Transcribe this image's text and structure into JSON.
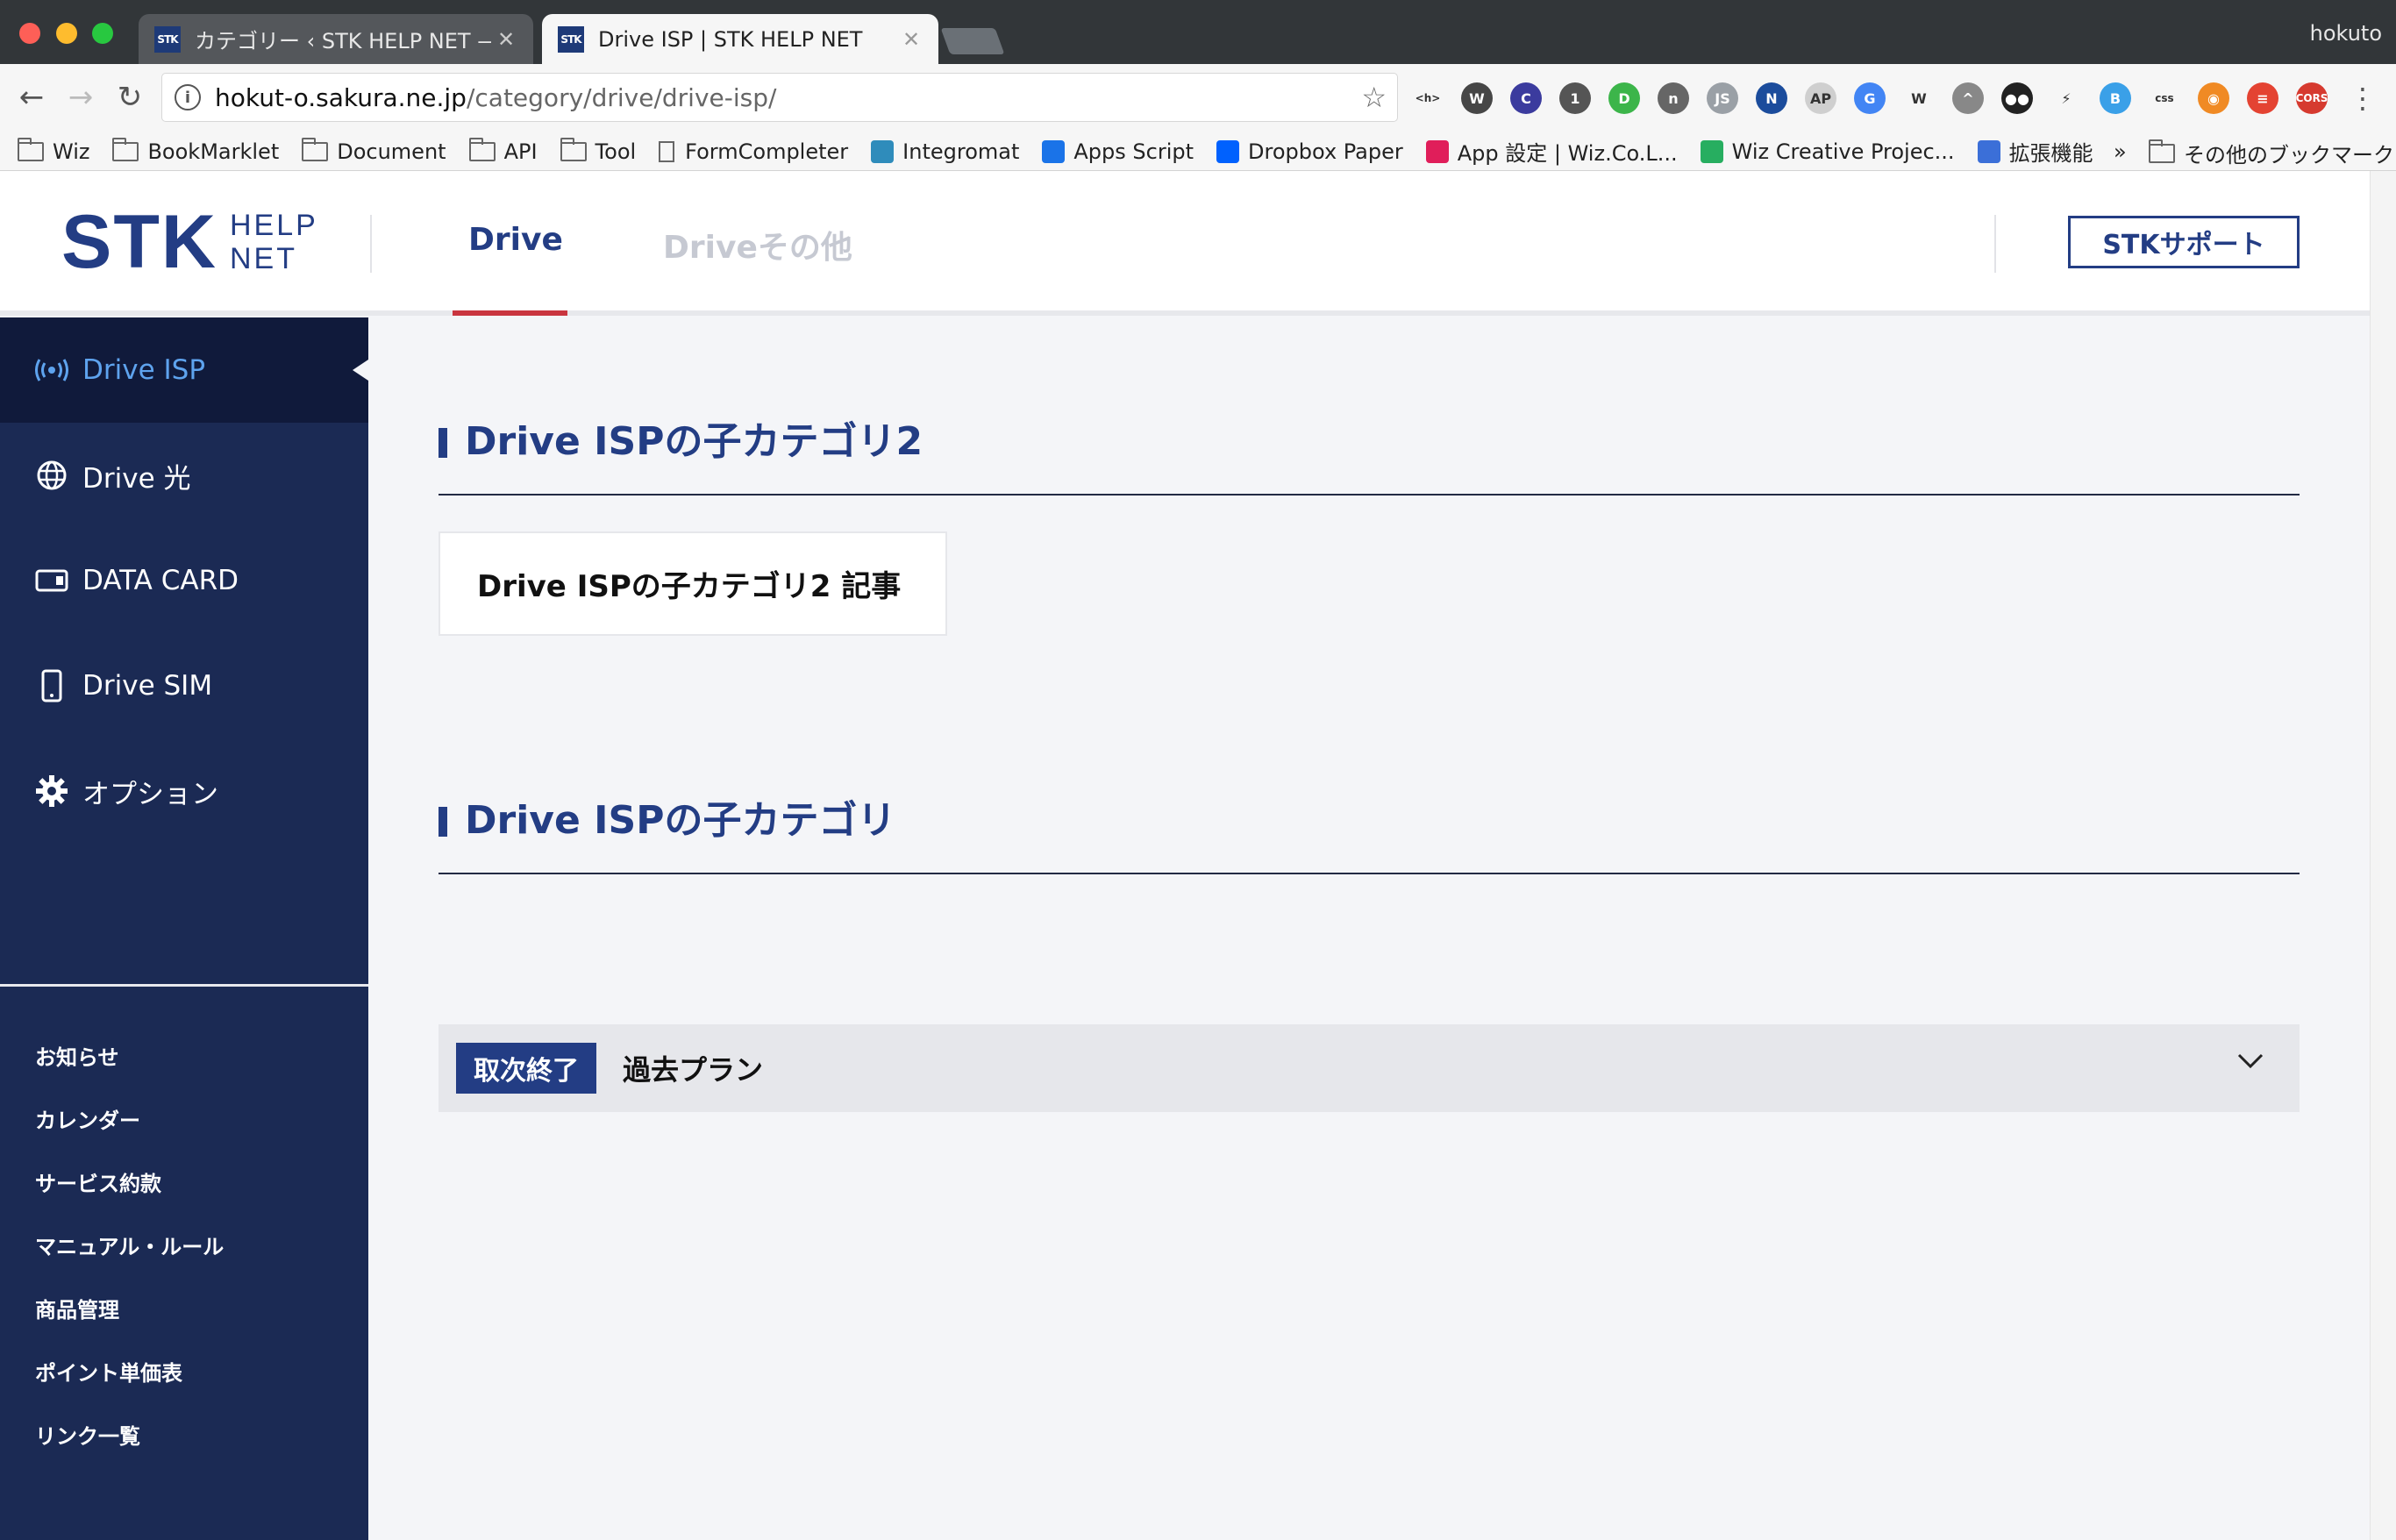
{
  "browser": {
    "tabs": [
      {
        "favicon": "STK",
        "title": "カテゴリー ‹ STK HELP NET —",
        "active": false
      },
      {
        "favicon": "STK",
        "title": "Drive ISP | STK HELP NET",
        "active": true
      }
    ],
    "profile_name": "hokuto",
    "url_host": "hokut-o.sakura.ne.jp",
    "url_path": "/category/drive/drive-isp/",
    "extensions": [
      {
        "icon": "html-tag-icon",
        "text": "<h>",
        "color": "#f6f6f6"
      },
      {
        "icon": "wordpress-icon",
        "text": "W",
        "color": "#464646"
      },
      {
        "icon": "c-circle-icon",
        "text": "C",
        "color": "#3b3b9e"
      },
      {
        "icon": "1password-icon",
        "text": "1",
        "color": "#555555"
      },
      {
        "icon": "green-d-icon",
        "text": "D",
        "color": "#3cb54a"
      },
      {
        "icon": "hex-n-icon",
        "text": "n",
        "color": "#666666"
      },
      {
        "icon": "js-icon",
        "text": "JS",
        "color": "#9aa0a6"
      },
      {
        "icon": "n-frame-icon",
        "text": "N",
        "color": "#1b4c9c"
      },
      {
        "icon": "ap-icon",
        "text": "AP",
        "color": "#cfcfcf"
      },
      {
        "icon": "translate-icon",
        "text": "G",
        "color": "#4285f4"
      },
      {
        "icon": "w-icon",
        "text": "W",
        "color": "#f6f6f6"
      },
      {
        "icon": "hat-icon",
        "text": "^",
        "color": "#888888"
      },
      {
        "icon": "tampermonkey-icon",
        "text": "●●",
        "color": "#222222"
      },
      {
        "icon": "bolt-icon",
        "text": "⚡",
        "color": "#f6f6f6"
      },
      {
        "icon": "pb-icon",
        "text": "B",
        "color": "#3aa0e8"
      },
      {
        "icon": "css-icon",
        "text": "css",
        "color": "#f6f6f6"
      },
      {
        "icon": "rss-icon",
        "text": "◉",
        "color": "#f08a24"
      },
      {
        "icon": "todoist-icon",
        "text": "≡",
        "color": "#e44332"
      },
      {
        "icon": "cors-icon",
        "text": "CORS",
        "color": "#d63a2f"
      }
    ],
    "bookmarks": [
      {
        "type": "folder",
        "label": "Wiz"
      },
      {
        "type": "folder",
        "label": "BookMarklet"
      },
      {
        "type": "folder",
        "label": "Document"
      },
      {
        "type": "folder",
        "label": "API"
      },
      {
        "type": "folder",
        "label": "Tool"
      },
      {
        "type": "page",
        "label": "FormCompleter"
      },
      {
        "type": "integromat",
        "label": "Integromat"
      },
      {
        "type": "apps-script",
        "label": "Apps Script"
      },
      {
        "type": "dropbox",
        "label": "Dropbox Paper"
      },
      {
        "type": "slack",
        "label": "App 設定 | Wiz.Co.L..."
      },
      {
        "type": "wiz",
        "label": "Wiz Creative Projec..."
      },
      {
        "type": "puzzle",
        "label": "拡張機能"
      }
    ],
    "bookmarks_overflow": "»",
    "other_bookmarks": "その他のブックマーク"
  },
  "site": {
    "logo_main": "STK",
    "logo_sub_1": "HELP",
    "logo_sub_2": "NET",
    "nav": [
      {
        "label": "Drive",
        "active": true
      },
      {
        "label": "Driveその他",
        "active": false
      }
    ],
    "support_button": "STKサポート"
  },
  "sidebar": {
    "items": [
      {
        "icon": "broadcast-icon",
        "label": "Drive ISP",
        "active": true
      },
      {
        "icon": "globe-icon",
        "label": "Drive 光",
        "active": false
      },
      {
        "icon": "card-icon",
        "label": "DATA CARD",
        "active": false
      },
      {
        "icon": "phone-icon",
        "label": "Drive SIM",
        "active": false
      },
      {
        "icon": "gear-icon",
        "label": "オプション",
        "active": false
      }
    ],
    "links": [
      "お知らせ",
      "カレンダー",
      "サービス約款",
      "マニュアル・ルール",
      "商品管理",
      "ポイント単価表",
      "リンク一覧"
    ]
  },
  "main": {
    "section1_title": "Drive ISPの子カテゴリ2",
    "article_title": "Drive ISPの子カテゴリ2 記事",
    "section2_title": "Drive ISPの子カテゴリ",
    "accordion_badge": "取次終了",
    "accordion_label": "過去プラン"
  },
  "colors": {
    "brand_navy": "#233d84",
    "sidebar_bg": "#1b2a54",
    "sidebar_active_bg": "#101a3b",
    "active_link": "#5ea3ee",
    "nav_underline": "#c9353f"
  }
}
